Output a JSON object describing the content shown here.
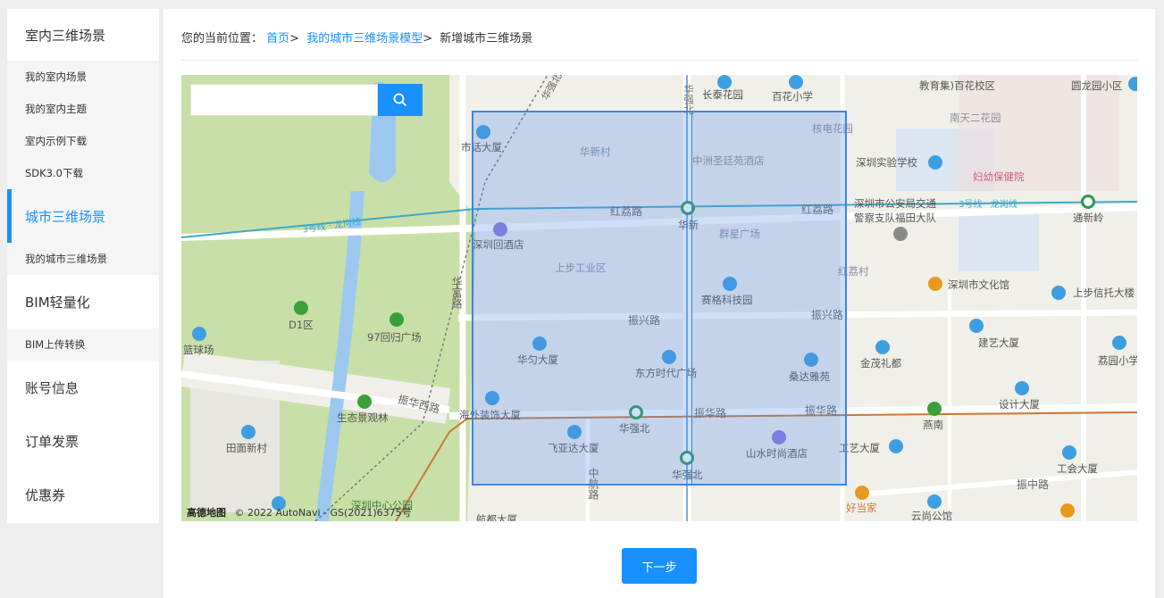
{
  "sidebar": {
    "items": [
      {
        "label": "室内三维场景",
        "type": "head"
      },
      {
        "label": "我的室内场景",
        "type": "sub"
      },
      {
        "label": "我的室内主题",
        "type": "sub"
      },
      {
        "label": "室内示例下载",
        "type": "sub"
      },
      {
        "label": "SDK3.0下载",
        "type": "sub"
      },
      {
        "label": "城市三维场景",
        "type": "head",
        "active": true
      },
      {
        "label": "我的城市三维场景",
        "type": "sub"
      },
      {
        "label": "BIM轻量化",
        "type": "head"
      },
      {
        "label": "BIM上传转换",
        "type": "sub"
      },
      {
        "label": "账号信息",
        "type": "head"
      },
      {
        "label": "订单发票",
        "type": "head"
      },
      {
        "label": "优惠券",
        "type": "head"
      }
    ]
  },
  "breadcrumb": {
    "prefix": "您的当前位置：",
    "home": "首页",
    "parent": "我的城市三维场景模型",
    "current": "新增城市三维场景",
    "separator": ">"
  },
  "map": {
    "search_placeholder": "",
    "search_icon": "search-icon",
    "attribution_logo": "高德地图",
    "attribution_text": "© 2022 AutoNavi - GS(2021)6375号",
    "labels": {
      "l1": "长泰花园",
      "l2": "百花小学",
      "l3": "教育集)百花校区",
      "l4": "圆龙园小区",
      "l5": "南天二花园",
      "l6": "核电花园",
      "l7": "华新村",
      "l8": "中洲圣廷苑酒店",
      "l9": "市话大厦",
      "l10": "深圳实验学校",
      "l11": "妇幼保健院",
      "l12": "红荔路",
      "l13": "红荔路",
      "l14": "华新",
      "l15": "深圳市公安局交通",
      "l16": "警察支队福田大队",
      "l17": "3号线 · 龙岗线",
      "l18": "通新岭",
      "l19": "3号线 · 龙岗线",
      "l20": "深圳回酒店",
      "l21": "群星广场",
      "l22": "上步工业区",
      "l23": "红荔村",
      "l24": "深圳市文化馆",
      "l25": "上步信托大楼",
      "l26": "赛格科技园",
      "l27": "华富路",
      "l28": "D1区",
      "l29": "97回归广场",
      "l30": "振兴路",
      "l31": "振兴路",
      "l32": "建艺大厦",
      "l33": "荔园小学",
      "l34": "篮球场",
      "l35": "华匀大厦",
      "l36": "东方时代广场",
      "l37": "桑达雅苑",
      "l38": "金茂礼都",
      "l39": "设计大厦",
      "l40": "华强北",
      "l41": "振华路",
      "l42": "振华路",
      "l43": "燕南",
      "l44": "海外装饰大厦",
      "l45": "华强北",
      "l46": "振华西路",
      "l47": "生态景观林",
      "l48": "田面新村",
      "l49": "飞亚达大厦",
      "l50": "山水时尚酒店",
      "l51": "工艺大厦",
      "l52": "工会大厦",
      "l53": "振中路",
      "l54": "华强北",
      "l55": "中航路",
      "l56": "深圳中心公园",
      "l57": "好当家",
      "l58": "云尚公馆",
      "l59": "航都大厦",
      "l60": "华强北路"
    }
  },
  "actions": {
    "next_label": "下一步"
  },
  "colors": {
    "accent": "#1890ff",
    "selection_border": "#3a86e8",
    "selection_fill": "rgba(80,140,235,0.28)",
    "park": "#c9dfa8",
    "water": "#9cc8f0",
    "metro_line": "#3ea8c8",
    "rail": "#c8783a"
  }
}
